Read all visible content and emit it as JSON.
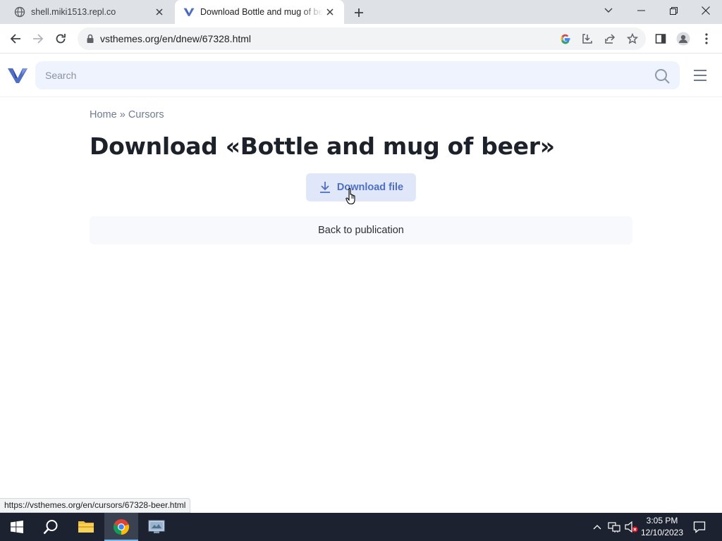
{
  "browser": {
    "tabs": [
      {
        "title": "shell.miki1513.repl.co",
        "active": false
      },
      {
        "title": "Download Bottle and mug of beer",
        "active": true
      }
    ],
    "url": "vsthemes.org/en/dnew/67328.html",
    "status_url": "https://vsthemes.org/en/cursors/67328-beer.html"
  },
  "site": {
    "search_placeholder": "Search",
    "breadcrumb": {
      "home": "Home",
      "separator": "»",
      "section": "Cursors"
    },
    "page_title": "Download «Bottle and mug of beer»",
    "download_label": "Download file",
    "back_label": "Back to publication",
    "accent_color": "#4f6fc4"
  },
  "taskbar": {
    "clock_time": "3:05 PM",
    "clock_date": "12/10/2023",
    "apps": [
      "start-icon",
      "search-icon",
      "file-explorer-icon",
      "chrome-icon",
      "remote-desktop-icon"
    ]
  }
}
